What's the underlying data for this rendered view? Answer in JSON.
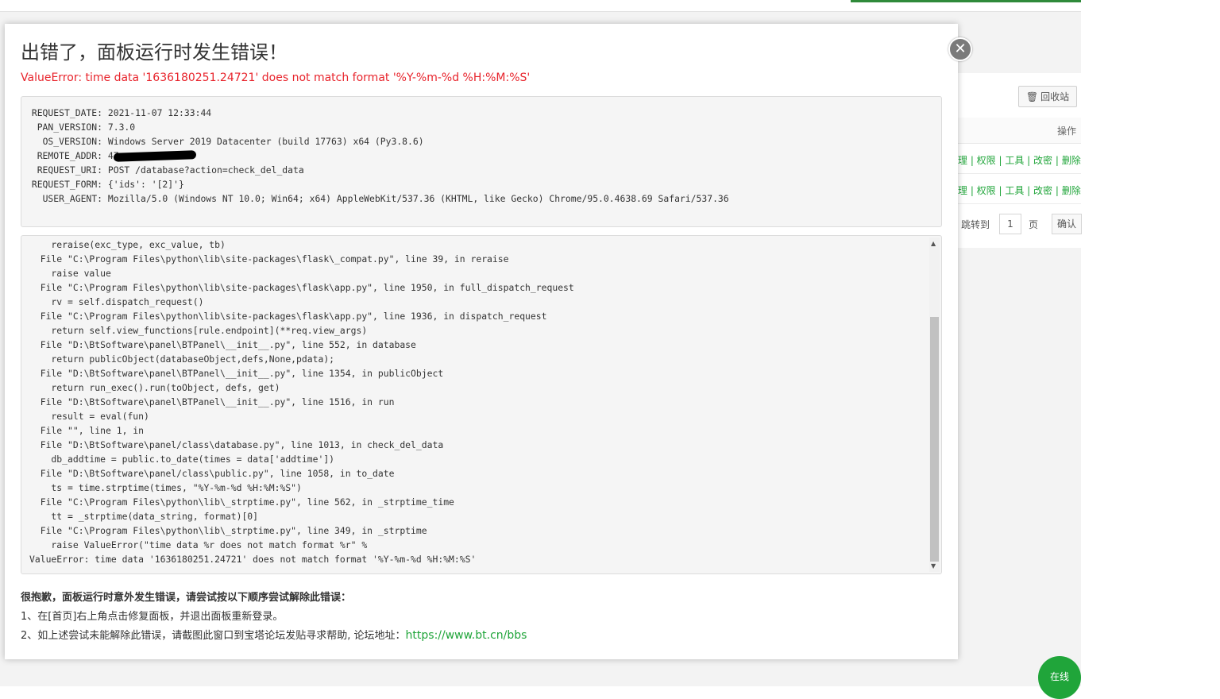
{
  "background": {
    "recycle_label": "回收站",
    "op_header": "操作",
    "row_actions": "理 | 权限 | 工具 | 改密 | 删除",
    "jump_label": "跳转到",
    "page_value": "1",
    "page_unit": "页",
    "confirm_label": "确认",
    "online_label": "在线"
  },
  "dialog": {
    "close_glyph": "✕",
    "title": "出错了，面板运行时发生错误！",
    "error_message": "ValueError: time data '1636180251.24721' does not match format '%Y-%m-%d %H:%M:%S'",
    "info": [
      {
        "key": "REQUEST_DATE:",
        "value": "2021-11-07 12:33:44"
      },
      {
        "key": "PAN_VERSION:",
        "value": "7.3.0"
      },
      {
        "key": "OS_VERSION:",
        "value": "Windows Server 2019 Datacenter (build 17763) x64 (Py3.8.6)"
      },
      {
        "key": "REMOTE_ADDR:",
        "value": "47."
      },
      {
        "key": "REQUEST_URI:",
        "value": "POST /database?action=check_del_data"
      },
      {
        "key": "REQUEST_FORM:",
        "value": "{'ids': '[2]'}"
      },
      {
        "key": "USER_AGENT:",
        "value": "Mozilla/5.0 (Windows NT 10.0; Win64; x64) AppleWebKit/537.36 (KHTML, like Gecko) Chrome/95.0.4638.69 Safari/537.36"
      }
    ],
    "traceback": [
      "    reraise(exc_type, exc_value, tb)",
      "  File \"C:\\Program Files\\python\\lib\\site-packages\\flask\\_compat.py\", line 39, in reraise",
      "    raise value",
      "  File \"C:\\Program Files\\python\\lib\\site-packages\\flask\\app.py\", line 1950, in full_dispatch_request",
      "    rv = self.dispatch_request()",
      "  File \"C:\\Program Files\\python\\lib\\site-packages\\flask\\app.py\", line 1936, in dispatch_request",
      "    return self.view_functions[rule.endpoint](**req.view_args)",
      "  File \"D:\\BtSoftware\\panel\\BTPanel\\__init__.py\", line 552, in database",
      "    return publicObject(databaseObject,defs,None,pdata);",
      "  File \"D:\\BtSoftware\\panel\\BTPanel\\__init__.py\", line 1354, in publicObject",
      "    return run_exec().run(toObject, defs, get)",
      "  File \"D:\\BtSoftware\\panel\\BTPanel\\__init__.py\", line 1516, in run",
      "    result = eval(fun)",
      "  File \"\", line 1, in",
      "  File \"D:\\BtSoftware\\panel/class\\database.py\", line 1013, in check_del_data",
      "    db_addtime = public.to_date(times = data['addtime'])",
      "  File \"D:\\BtSoftware\\panel/class\\public.py\", line 1058, in to_date",
      "    ts = time.strptime(times, \"%Y-%m-%d %H:%M:%S\")",
      "  File \"C:\\Program Files\\python\\lib\\_strptime.py\", line 562, in _strptime_time",
      "    tt = _strptime(data_string, format)[0]",
      "  File \"C:\\Program Files\\python\\lib\\_strptime.py\", line 349, in _strptime",
      "    raise ValueError(\"time data %r does not match format %r\" %",
      "ValueError: time data '1636180251.24721' does not match format '%Y-%m-%d %H:%M:%S'"
    ],
    "help_title": "很抱歉，面板运行时意外发生错误，请尝试按以下顺序尝试解除此错误：",
    "help_step1": "1、在[首页]右上角点击修复面板，并退出面板重新登录。",
    "help_step2_prefix": "2、如上述尝试未能解除此错误，请截图此窗口到宝塔论坛发贴寻求帮助, 论坛地址：",
    "help_link": "https://www.bt.cn/bbs"
  }
}
